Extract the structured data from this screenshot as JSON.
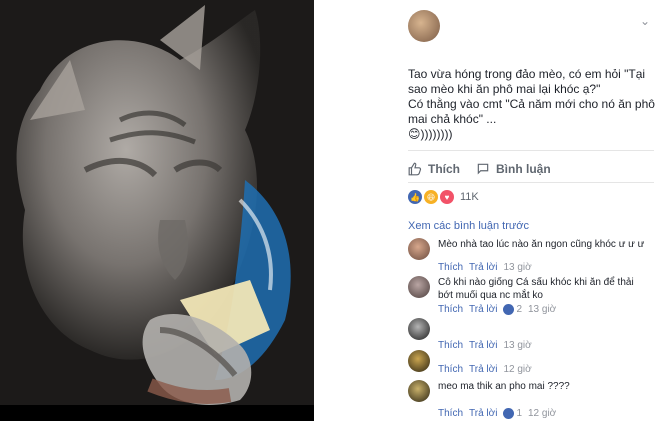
{
  "post": {
    "text": "Tao vừa hóng trong đảo mèo, có em hỏi \"Tại sao mèo khi ăn phô mai lại khóc ạ?\"\nCó thằng vào cmt \"Cả năm mới cho nó ăn phô mai chả khóc\" ...",
    "emoji_tail": "😊))))))))"
  },
  "actions": {
    "like_label": "Thích",
    "comment_label": "Bình luận"
  },
  "reactions": {
    "count": "11K"
  },
  "comments_section": {
    "view_previous": "Xem các bình luận trước"
  },
  "comments": [
    {
      "text": "Mèo nhà tao lúc nào ăn ngon cũng khóc ư ư ư",
      "like": "Thích",
      "reply": "Trả lời",
      "time": "13 giờ",
      "reaction_count": ""
    },
    {
      "text": "Cô khi nào giống Cá sấu khóc khi ăn để thải bớt muối qua nc mắt ko",
      "like": "Thích",
      "reply": "Trả lời",
      "time": "13 giờ",
      "reaction_count": "2"
    },
    {
      "text": "",
      "like": "Thích",
      "reply": "Trả lời",
      "time": "13 giờ",
      "reaction_count": ""
    },
    {
      "text": "",
      "like": "Thích",
      "reply": "Trả lời",
      "time": "12 giờ",
      "reaction_count": ""
    },
    {
      "text": "meo ma thik an pho mai ????",
      "like": "Thích",
      "reply": "Trả lời",
      "time": "12 giờ",
      "reaction_count": "1"
    }
  ],
  "colors": {
    "link": "#4267b2",
    "text": "#1d2129",
    "muted": "#90949c"
  }
}
